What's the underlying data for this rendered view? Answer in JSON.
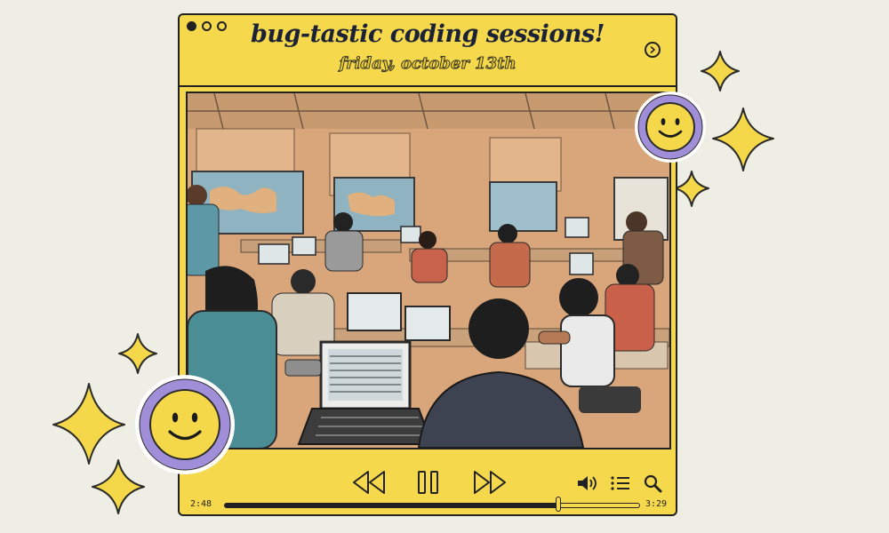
{
  "window": {
    "title": "bug-tastic coding sessions!",
    "subtitle": "friday, october 13th"
  },
  "player": {
    "elapsed": "2:48",
    "duration": "3:29",
    "progress": 0.804
  },
  "icons": {
    "window_dots": [
      "dot-filled",
      "dot-outline",
      "dot-outline"
    ],
    "header_action": "chevron-right-circle-icon",
    "controls": [
      "rewind-icon",
      "pause-icon",
      "fast-forward-icon",
      "volume-icon",
      "playlist-icon",
      "search-icon"
    ],
    "decorations": [
      "smiley-face-icon",
      "sparkle-icon"
    ]
  },
  "colors": {
    "background": "#efeee4",
    "player": "#f6d84d",
    "outline": "#222222",
    "smiley_ring": "#a08fd8",
    "sparkle": "#f5d84a"
  }
}
